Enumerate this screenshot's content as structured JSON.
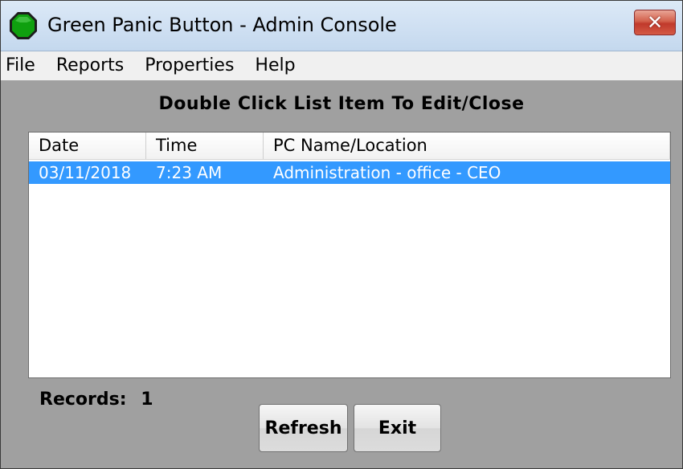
{
  "window": {
    "title": "Green Panic Button - Admin Console",
    "close_glyph": "✕",
    "app_icon": "green-octagon-icon",
    "colors": {
      "selection": "#3399ff",
      "client_bg": "#a0a0a0",
      "icon_green": "#0fa00f"
    }
  },
  "menu": {
    "items": [
      "File",
      "Reports",
      "Properties",
      "Help"
    ]
  },
  "main": {
    "heading": "Double Click List Item To Edit/Close",
    "list": {
      "columns": [
        "Date",
        "Time",
        "PC Name/Location"
      ],
      "rows": [
        {
          "date": "03/11/2018",
          "time": "7:23 AM",
          "pc": "Administration - office - CEO",
          "selected": true
        }
      ]
    },
    "records_label": "Records:",
    "records_count": "1"
  },
  "buttons": {
    "refresh": "Refresh",
    "exit": "Exit"
  }
}
